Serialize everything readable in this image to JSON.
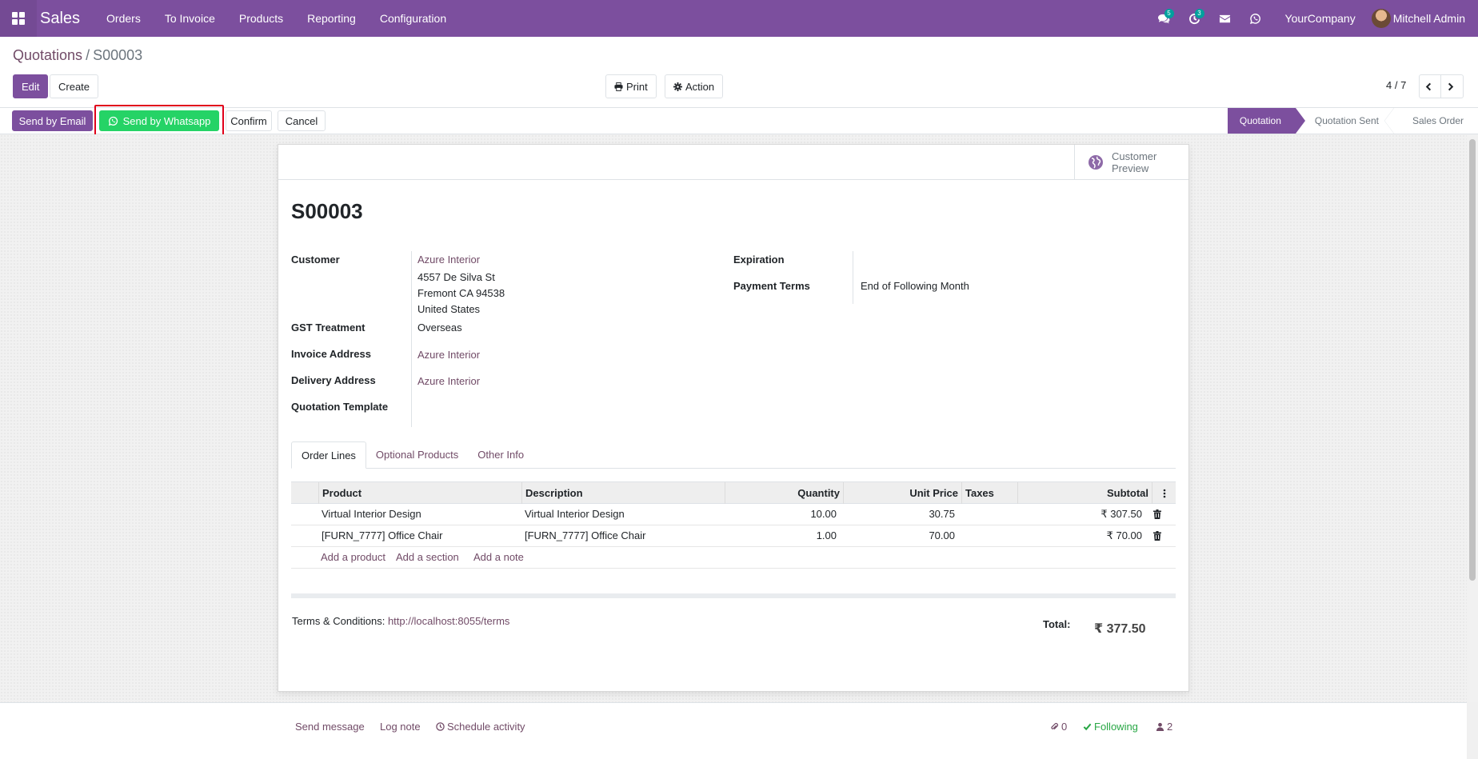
{
  "navbar": {
    "app_name": "Sales",
    "menu": [
      "Orders",
      "To Invoice",
      "Products",
      "Reporting",
      "Configuration"
    ],
    "messages_badge": "5",
    "activities_badge": "3",
    "company": "YourCompany",
    "user": "Mitchell Admin"
  },
  "breadcrumb": {
    "parent": "Quotations",
    "separator": "/",
    "current": "S00003"
  },
  "buttons": {
    "edit": "Edit",
    "create": "Create",
    "print": "Print",
    "action": "Action"
  },
  "pager": {
    "value": "4 / 7"
  },
  "status_buttons": {
    "send_email": "Send by Email",
    "send_whatsapp": "Send by Whatsapp",
    "confirm": "Confirm",
    "cancel": "Cancel"
  },
  "stages": [
    "Quotation",
    "Quotation Sent",
    "Sales Order"
  ],
  "active_stage": "Quotation",
  "form": {
    "preview_line1": "Customer",
    "preview_line2": "Preview",
    "name": "S00003",
    "customer_label": "Customer",
    "customer_name": "Azure Interior",
    "customer_address": [
      "4557 De Silva St",
      "Fremont CA 94538",
      "United States"
    ],
    "gst_label": "GST Treatment",
    "gst_value": "Overseas",
    "invoice_label": "Invoice Address",
    "invoice_value": "Azure Interior",
    "delivery_label": "Delivery Address",
    "delivery_value": "Azure Interior",
    "template_label": "Quotation Template",
    "expiration_label": "Expiration",
    "payment_label": "Payment Terms",
    "payment_value": "End of Following Month"
  },
  "tabs": [
    "Order Lines",
    "Optional Products",
    "Other Info"
  ],
  "lines": {
    "headers": [
      "Product",
      "Description",
      "Quantity",
      "Unit Price",
      "Taxes",
      "Subtotal"
    ],
    "rows": [
      {
        "product": "Virtual Interior Design",
        "description": "Virtual Interior Design",
        "quantity": "10.00",
        "unit_price": "30.75",
        "taxes": "",
        "subtotal": "₹ 307.50"
      },
      {
        "product": "[FURN_7777] Office Chair",
        "description": "[FURN_7777] Office Chair",
        "quantity": "1.00",
        "unit_price": "70.00",
        "taxes": "",
        "subtotal": "₹ 70.00"
      }
    ],
    "add_product": "Add a product",
    "add_section": "Add a section",
    "add_note": "Add a note"
  },
  "terms": {
    "label": "Terms & Conditions:",
    "link": "http://localhost:8055/terms"
  },
  "total": {
    "label": "Total:",
    "value": "₹ 377.50"
  },
  "chatter": {
    "send_message": "Send message",
    "log_note": "Log note",
    "schedule": "Schedule activity",
    "attachments": "0",
    "following": "Following",
    "followers": "2"
  },
  "colors": {
    "brand": "#7C4F9E",
    "whatsapp": "#25D366",
    "highlight": "#e0001a"
  }
}
